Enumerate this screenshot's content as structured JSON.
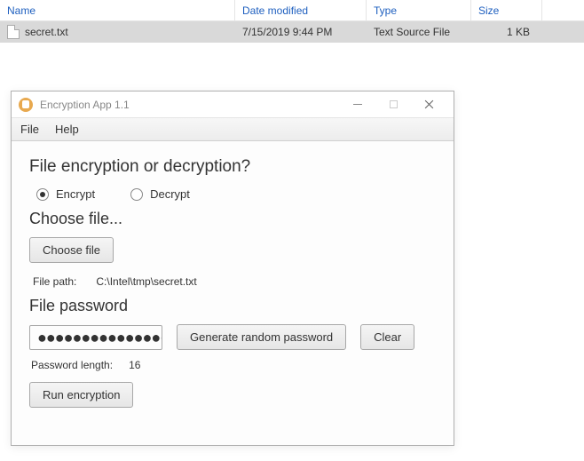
{
  "explorer": {
    "columns": {
      "name": "Name",
      "date": "Date modified",
      "type": "Type",
      "size": "Size"
    },
    "rows": [
      {
        "name": "secret.txt",
        "date": "7/15/2019 9:44 PM",
        "type": "Text Source File",
        "size": "1 KB"
      }
    ]
  },
  "window": {
    "title": "Encryption App 1.1",
    "menu": {
      "file": "File",
      "help": "Help"
    },
    "q_heading": "File encryption or decryption?",
    "radio_encrypt": "Encrypt",
    "radio_decrypt": "Decrypt",
    "choose_heading": "Choose file...",
    "choose_btn": "Choose file",
    "filepath_label": "File path:",
    "filepath_value": "C:\\Intel\\tmp\\secret.txt",
    "pwd_heading": "File password",
    "pwd_masked": "●●●●●●●●●●●●●●●●",
    "gen_btn": "Generate random password",
    "clear_btn": "Clear",
    "pwdlen_label": "Password length:",
    "pwdlen_value": "16",
    "run_btn": "Run encryption"
  }
}
